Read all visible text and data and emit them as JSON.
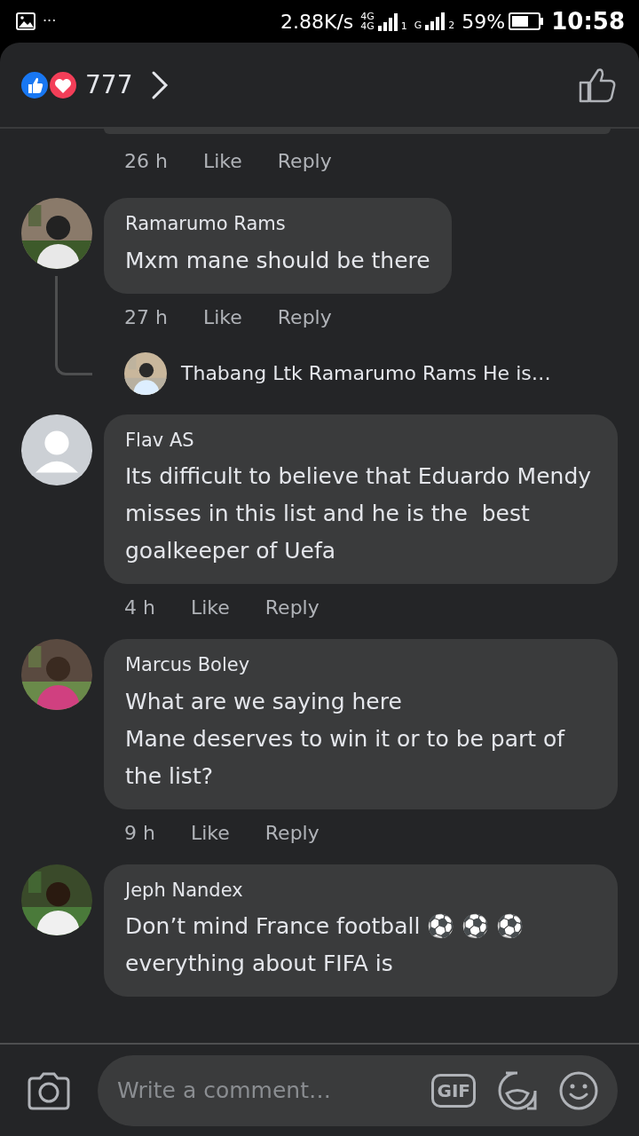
{
  "status_bar": {
    "overflow": "···",
    "speed": "2.88K/s",
    "sims": [
      {
        "network": [
          "4G",
          "4G"
        ],
        "slot": "1"
      },
      {
        "network": [
          "G"
        ],
        "slot": "2"
      }
    ],
    "battery": "59%",
    "time": "10:58"
  },
  "header": {
    "reaction_count": "777"
  },
  "partial_comment": {
    "time": "26 h",
    "actions": [
      "Like",
      "Reply"
    ]
  },
  "comments": [
    {
      "avatar": {
        "kind": "picture"
      },
      "author": "Ramarumo Rams",
      "text": "Mxm mane should be there",
      "time": "27 h",
      "actions": [
        "Like",
        "Reply"
      ],
      "replies": [
        {
          "avatar": {
            "kind": "picture"
          },
          "preview": "Thabang Ltk Ramarumo Rams He is…"
        }
      ]
    },
    {
      "avatar": {
        "kind": "default"
      },
      "author": "Flav AS",
      "text": "Its difficult to believe that Eduardo Mendy misses in this list and he is the  best goalkeeper of Uefa",
      "time": "4 h",
      "actions": [
        "Like",
        "Reply"
      ]
    },
    {
      "avatar": {
        "kind": "picture"
      },
      "author": "Marcus Boley",
      "text": "What are we saying here\nMane deserves to win it or to be part of the list?",
      "time": "9 h",
      "actions": [
        "Like",
        "Reply"
      ]
    },
    {
      "avatar": {
        "kind": "picture"
      },
      "author": "Jeph Nandex",
      "text": "Don’t mind France football ⚽ ⚽ ⚽ everything about FIFA is"
    }
  ],
  "composer": {
    "placeholder": "Write a comment…",
    "gif_label": "GIF"
  }
}
